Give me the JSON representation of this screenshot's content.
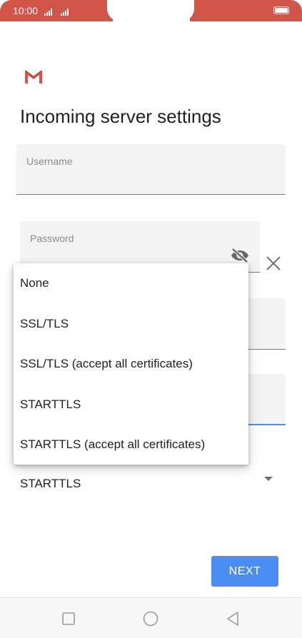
{
  "status_bar": {
    "time": "10:00",
    "accent_color": "#d2554a"
  },
  "brand": {
    "logo_icon": "gmail-icon"
  },
  "page": {
    "title": "Incoming server settings"
  },
  "fields": {
    "username_label": "Username",
    "password_label": "Password"
  },
  "security": {
    "selected": "STARTTLS",
    "options": [
      "None",
      "SSL/TLS",
      "SSL/TLS (accept all certificates)",
      "STARTTLS",
      "STARTTLS (accept all certificates)"
    ]
  },
  "actions": {
    "next_label": "NEXT",
    "primary_color": "#4a8ef1"
  }
}
